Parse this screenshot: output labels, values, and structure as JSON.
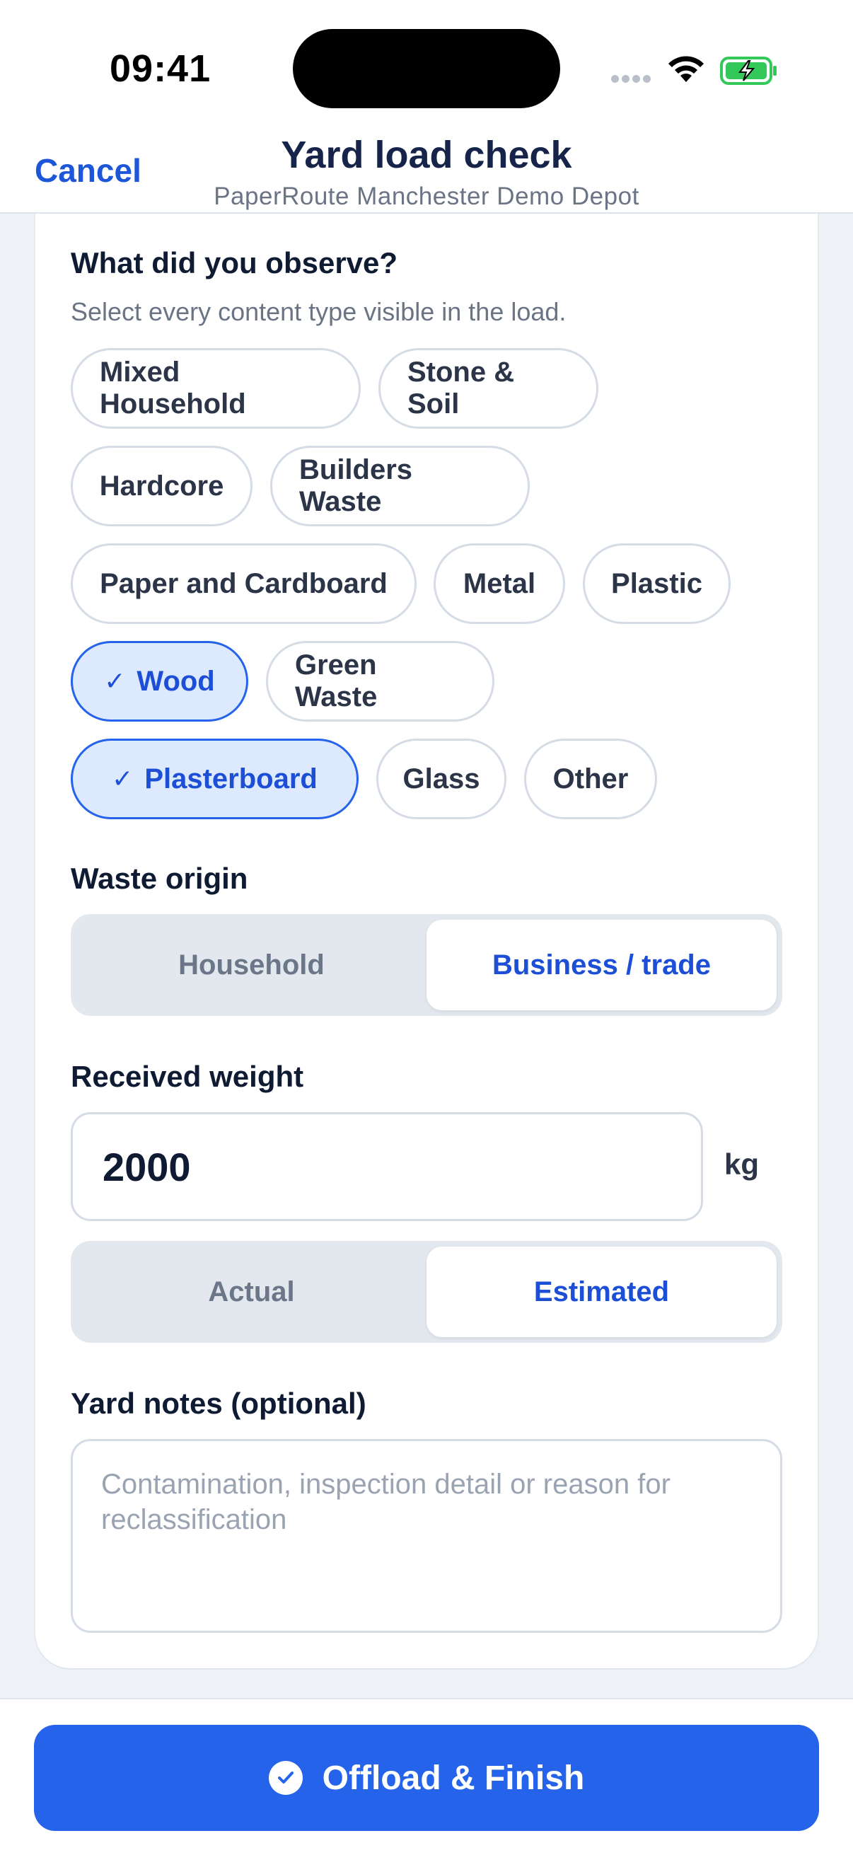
{
  "status_bar": {
    "time": "09:41"
  },
  "header": {
    "cancel_label": "Cancel",
    "title": "Yard load check",
    "subtitle": "PaperRoute Manchester Demo Depot"
  },
  "observe": {
    "heading": "What did you observe?",
    "hint": "Select every content type visible in the load.",
    "chips": [
      {
        "label": "Mixed Household",
        "selected": false
      },
      {
        "label": "Stone & Soil",
        "selected": false
      },
      {
        "label": "Hardcore",
        "selected": false
      },
      {
        "label": "Builders Waste",
        "selected": false
      },
      {
        "label": "Paper and Cardboard",
        "selected": false
      },
      {
        "label": "Metal",
        "selected": false
      },
      {
        "label": "Plastic",
        "selected": false
      },
      {
        "label": "Wood",
        "selected": true
      },
      {
        "label": "Green Waste",
        "selected": false
      },
      {
        "label": "Plasterboard",
        "selected": true
      },
      {
        "label": "Glass",
        "selected": false
      },
      {
        "label": "Other",
        "selected": false
      }
    ]
  },
  "origin": {
    "heading": "Waste origin",
    "options": [
      "Household",
      "Business / trade"
    ],
    "selected": "Business / trade"
  },
  "weight": {
    "heading": "Received weight",
    "value": "2000",
    "unit": "kg",
    "modes": [
      "Actual",
      "Estimated"
    ],
    "selected_mode": "Estimated"
  },
  "notes": {
    "heading": "Yard notes (optional)",
    "placeholder": "Contamination, inspection detail or reason for reclassification"
  },
  "actions": {
    "finish_label": "Offload & Finish"
  },
  "colors": {
    "accent": "#2563eb",
    "selected_chip_bg": "#dde9fc",
    "title": "#17244a"
  }
}
